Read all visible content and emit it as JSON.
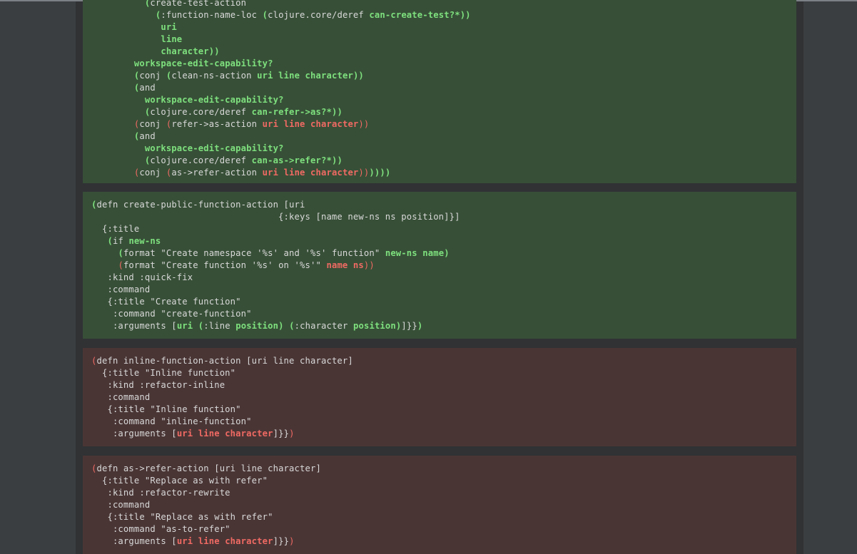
{
  "blocks": [
    {
      "status": "covered",
      "lines": [
        [
          {
            "t": "          "
          },
          {
            "t": "(",
            "c": "pg"
          },
          {
            "t": "create-test-action"
          }
        ],
        [
          {
            "t": "            "
          },
          {
            "t": "(",
            "c": "pg"
          },
          {
            "t": ":function-name-loc "
          },
          {
            "t": "(",
            "c": "pg"
          },
          {
            "t": "clojure.core/deref "
          },
          {
            "t": "can-create-test?*",
            "c": "g"
          },
          {
            "t": "))",
            "c": "pg"
          }
        ],
        [
          {
            "t": "             "
          },
          {
            "t": "uri",
            "c": "g"
          }
        ],
        [
          {
            "t": "             "
          },
          {
            "t": "line",
            "c": "g"
          }
        ],
        [
          {
            "t": "             "
          },
          {
            "t": "character",
            "c": "g"
          },
          {
            "t": "))",
            "c": "pg"
          }
        ],
        [
          {
            "t": "        "
          },
          {
            "t": "workspace-edit-capability?",
            "c": "g"
          }
        ],
        [
          {
            "t": "        "
          },
          {
            "t": "(",
            "c": "pg"
          },
          {
            "t": "conj "
          },
          {
            "t": "(",
            "c": "pg"
          },
          {
            "t": "clean-ns-action "
          },
          {
            "t": "uri line character",
            "c": "g"
          },
          {
            "t": "))",
            "c": "pg"
          }
        ],
        [
          {
            "t": "        "
          },
          {
            "t": "(",
            "c": "pg"
          },
          {
            "t": "and"
          }
        ],
        [
          {
            "t": "          "
          },
          {
            "t": "workspace-edit-capability?",
            "c": "g"
          }
        ],
        [
          {
            "t": "          "
          },
          {
            "t": "(",
            "c": "pg"
          },
          {
            "t": "clojure.core/deref "
          },
          {
            "t": "can-refer->as?*",
            "c": "g"
          },
          {
            "t": "))",
            "c": "pg"
          }
        ],
        [
          {
            "t": "        "
          },
          {
            "t": "(",
            "c": "pr"
          },
          {
            "t": "conj "
          },
          {
            "t": "(",
            "c": "pr"
          },
          {
            "t": "refer->as-action "
          },
          {
            "t": "uri line character",
            "c": "r"
          },
          {
            "t": "))",
            "c": "pr"
          }
        ],
        [
          {
            "t": "        "
          },
          {
            "t": "(",
            "c": "pg"
          },
          {
            "t": "and"
          }
        ],
        [
          {
            "t": "          "
          },
          {
            "t": "workspace-edit-capability?",
            "c": "g"
          }
        ],
        [
          {
            "t": "          "
          },
          {
            "t": "(",
            "c": "pg"
          },
          {
            "t": "clojure.core/deref "
          },
          {
            "t": "can-as->refer?*",
            "c": "g"
          },
          {
            "t": "))",
            "c": "pg"
          }
        ],
        [
          {
            "t": "        "
          },
          {
            "t": "(",
            "c": "pr"
          },
          {
            "t": "conj "
          },
          {
            "t": "(",
            "c": "pr"
          },
          {
            "t": "as->refer-action "
          },
          {
            "t": "uri line character",
            "c": "r"
          },
          {
            "t": "))",
            "c": "pr"
          },
          {
            "t": "))))",
            "c": "pg"
          }
        ]
      ]
    },
    {
      "status": "covered",
      "lines": [
        [
          {
            "t": "(",
            "c": "pg"
          },
          {
            "t": "defn create-public-function-action [uri"
          }
        ],
        [
          {
            "t": "                                   {:keys [name new-ns ns position]}]"
          }
        ],
        [
          {
            "t": "  {:title"
          }
        ],
        [
          {
            "t": "   "
          },
          {
            "t": "(",
            "c": "pg"
          },
          {
            "t": "if "
          },
          {
            "t": "new-ns",
            "c": "g"
          }
        ],
        [
          {
            "t": "     "
          },
          {
            "t": "(",
            "c": "pg"
          },
          {
            "t": "format \"Create namespace '%s' and '%s' function\" "
          },
          {
            "t": "new-ns name",
            "c": "g"
          },
          {
            "t": ")",
            "c": "pg"
          }
        ],
        [
          {
            "t": "     "
          },
          {
            "t": "(",
            "c": "pr"
          },
          {
            "t": "format \"Create function '%s' on '%s'\" "
          },
          {
            "t": "name ns",
            "c": "r"
          },
          {
            "t": "))",
            "c": "pr"
          }
        ],
        [
          {
            "t": "   :kind :quick-fix"
          }
        ],
        [
          {
            "t": "   :command"
          }
        ],
        [
          {
            "t": "   {:title \"Create function\""
          }
        ],
        [
          {
            "t": "    :command \"create-function\""
          }
        ],
        [
          {
            "t": "    :arguments ["
          },
          {
            "t": "uri",
            "c": "g"
          },
          {
            "t": " "
          },
          {
            "t": "(",
            "c": "pg"
          },
          {
            "t": ":line "
          },
          {
            "t": "position",
            "c": "g"
          },
          {
            "t": ")",
            "c": "pg"
          },
          {
            "t": " "
          },
          {
            "t": "(",
            "c": "pg"
          },
          {
            "t": ":character "
          },
          {
            "t": "position",
            "c": "g"
          },
          {
            "t": ")",
            "c": "pg"
          },
          {
            "t": "]}}"
          },
          {
            "t": ")",
            "c": "pg"
          }
        ]
      ]
    },
    {
      "status": "uncovered",
      "lines": [
        [
          {
            "t": "(",
            "c": "pr"
          },
          {
            "t": "defn inline-function-action [uri line character]"
          }
        ],
        [
          {
            "t": "  {:title \"Inline function\""
          }
        ],
        [
          {
            "t": "   :kind :refactor-inline"
          }
        ],
        [
          {
            "t": "   :command"
          }
        ],
        [
          {
            "t": "   {:title \"Inline function\""
          }
        ],
        [
          {
            "t": "    :command \"inline-function\""
          }
        ],
        [
          {
            "t": "    :arguments ["
          },
          {
            "t": "uri line character",
            "c": "r"
          },
          {
            "t": "]}}"
          },
          {
            "t": ")",
            "c": "pr"
          }
        ]
      ]
    },
    {
      "status": "uncovered",
      "lines": [
        [
          {
            "t": "(",
            "c": "pr"
          },
          {
            "t": "defn as->refer-action [uri line character]"
          }
        ],
        [
          {
            "t": "  {:title \"Replace as with refer\""
          }
        ],
        [
          {
            "t": "   :kind :refactor-rewrite"
          }
        ],
        [
          {
            "t": "   :command"
          }
        ],
        [
          {
            "t": "   {:title \"Replace as with refer\""
          }
        ],
        [
          {
            "t": "    :command \"as-to-refer\""
          }
        ],
        [
          {
            "t": "    :arguments ["
          },
          {
            "t": "uri line character",
            "c": "r"
          },
          {
            "t": "]}}"
          },
          {
            "t": ")",
            "c": "pr"
          }
        ]
      ]
    }
  ]
}
